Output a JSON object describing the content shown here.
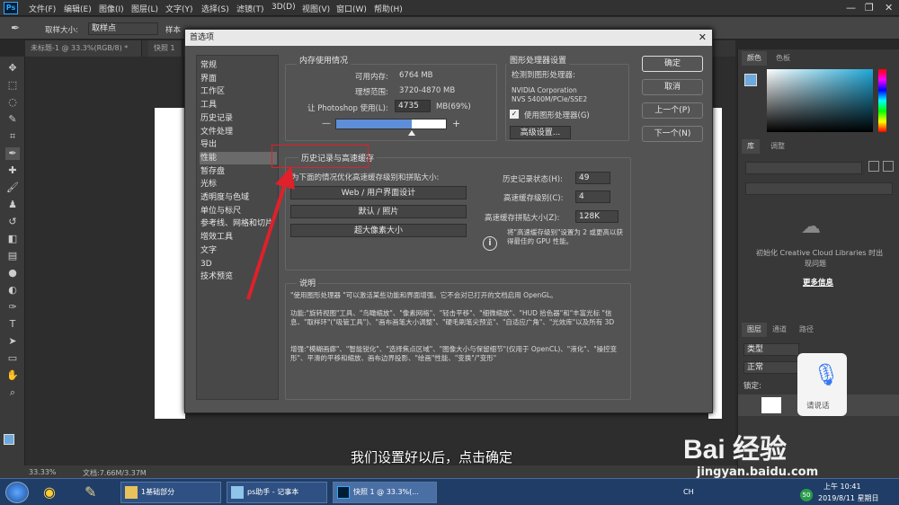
{
  "menubar": {
    "items": [
      "文件(F)",
      "编辑(E)",
      "图像(I)",
      "图层(L)",
      "文字(Y)",
      "选择(S)",
      "滤镜(T)",
      "3D(D)",
      "视图(V)",
      "窗口(W)",
      "帮助(H)"
    ]
  },
  "options": {
    "sample_size_label": "取样大小:",
    "sample_size_value": "取样点",
    "sample_label": "样本"
  },
  "doc_tabs": [
    "未标题-1 @ 33.3%(RGB/8) *",
    "快照 1"
  ],
  "status": {
    "zoom": "33.33%",
    "doc": "文档:7.66M/3.37M"
  },
  "dialog": {
    "title": "首选项",
    "nav": [
      "常规",
      "界面",
      "工作区",
      "工具",
      "历史记录",
      "文件处理",
      "导出",
      "性能",
      "暂存盘",
      "光标",
      "透明度与色域",
      "单位与标尺",
      "参考线、网格和切片",
      "增效工具",
      "文字",
      "3D",
      "技术预览"
    ],
    "memory": {
      "title": "内存使用情况",
      "available_label": "可用内存:",
      "available_value": "6764 MB",
      "ideal_label": "理想范围:",
      "ideal_value": "3720-4870 MB",
      "use_label": "让 Photoshop 使用(L):",
      "use_value": "4735",
      "use_suffix": "MB(69%)",
      "minus": "—",
      "plus": "+"
    },
    "gpu": {
      "title": "图形处理器设置",
      "detected": "检测到图形处理器:",
      "name1": "NVIDIA Corporation",
      "name2": "NVS 5400M/PCIe/SSE2",
      "use_gpu": "使用图形处理器(G)",
      "advanced": "高级设置..."
    },
    "buttons": {
      "ok": "确定",
      "cancel": "取消",
      "prev": "上一个(P)",
      "next": "下一个(N)"
    },
    "history": {
      "title": "历史记录与高速缓存",
      "optimize": "为下面的情况优化高速缓存级别和拼贴大小:",
      "b1": "Web / 用户界面设计",
      "b2": "默认 / 照片",
      "b3": "超大像素大小",
      "states_label": "历史记录状态(H):",
      "states_value": "49",
      "levels_label": "高速缓存级别(C):",
      "levels_value": "4",
      "tile_label": "高速缓存拼贴大小(Z):",
      "tile_value": "128K",
      "tip": "将\"高速缓存级别\"设置为 2 或更高以获得最佳的 GPU 性能。"
    },
    "desc": {
      "title": "说明",
      "p1": "\"使用图形处理器 \"可以激活某些功能和界面增强。它不会对已打开的文档启用 OpenGL。",
      "p2": "功能:\"旋转视图\"工具、\"鸟瞰缩放\"、\"像素网格\"、\"轻击平移\"、\"细微缩放\"、\"HUD 拾色器\"和\"丰富光标 \"信息、\"取样环\"(\"吸管工具\")、\"画布画笔大小调整\"、\"硬毛刷笔尖预览\"、\"自适应广角\"、\"光效库\"以及所有 3D",
      "p3": "增强:\"模糊画廊\"、\"智能锐化\"、\"选择焦点区域\"、\"图像大小与保留细节\"(仅用于 OpenCL)、\"液化\"、\"操控变形\"、平滑的平移和缩放、画布边界投影、\"绘画\"性能、\"变换\"/\"变形\""
    }
  },
  "panels": {
    "color_tab": "颜色",
    "swatch_tab": "色板",
    "lib_tab": "库",
    "adjust_tab": "调整",
    "lib_msg1": "初始化 Creative Cloud Libraries 时出",
    "lib_msg2": "现问题",
    "more_info": "更多信息",
    "layers_tab": "图层",
    "channels_tab": "通道",
    "paths_tab": "路径",
    "kind": "类型",
    "normal": "正常",
    "lock": "锁定:"
  },
  "overlay": {
    "subtitle": "我们设置好以后，点击确定",
    "voice": "请说话",
    "watermark": "Bai 经验",
    "url": "jingyan.baidu.com"
  },
  "taskbar": {
    "items": [
      "1基础部分",
      "ps助手 - 记事本",
      "快照 1 @ 33.3%(..."
    ],
    "time": "上午 10:41",
    "date": "2019/8/11 星期日",
    "ime": "CH"
  }
}
